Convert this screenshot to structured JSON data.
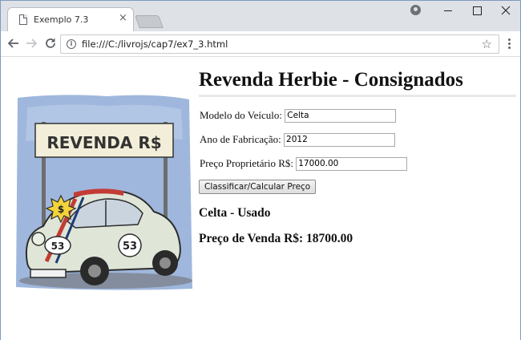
{
  "browser": {
    "tab_title": "Exemplo 7.3",
    "tab_close": "×",
    "url": "file:///C:/livrojs/cap7/ex7_3.html",
    "icons": {
      "page": "page-icon",
      "close": "close-icon",
      "back": "arrow-left-icon",
      "forward": "arrow-right-icon",
      "reload": "reload-icon",
      "info": "info-icon",
      "star": "star-icon",
      "menu": "kebab-menu-icon",
      "profile": "profile-icon"
    }
  },
  "illustration": {
    "banner_text": "REVENDA R$",
    "price_tag": "$",
    "car_number": "53"
  },
  "form": {
    "title": "Revenda Herbie - Consignados",
    "model_label": "Modelo do Veículo:",
    "model_value": "Celta",
    "year_label": "Ano de Fabricação:",
    "year_value": "2012",
    "price_label": "Preço Proprietário R$:",
    "price_value": "17000.00",
    "button_label": "Classificar/Calcular Preço"
  },
  "results": {
    "classification": "Celta - Usado",
    "sale_price": "Preço de Venda R$: 18700.00"
  },
  "colors": {
    "tab_strip": "#dee1e6",
    "frame": "#7c9bbd",
    "car_body": "#dfe6d8",
    "banner": "#f3eed9",
    "sky": "#9fb7dc",
    "tag": "#f2d33a"
  }
}
